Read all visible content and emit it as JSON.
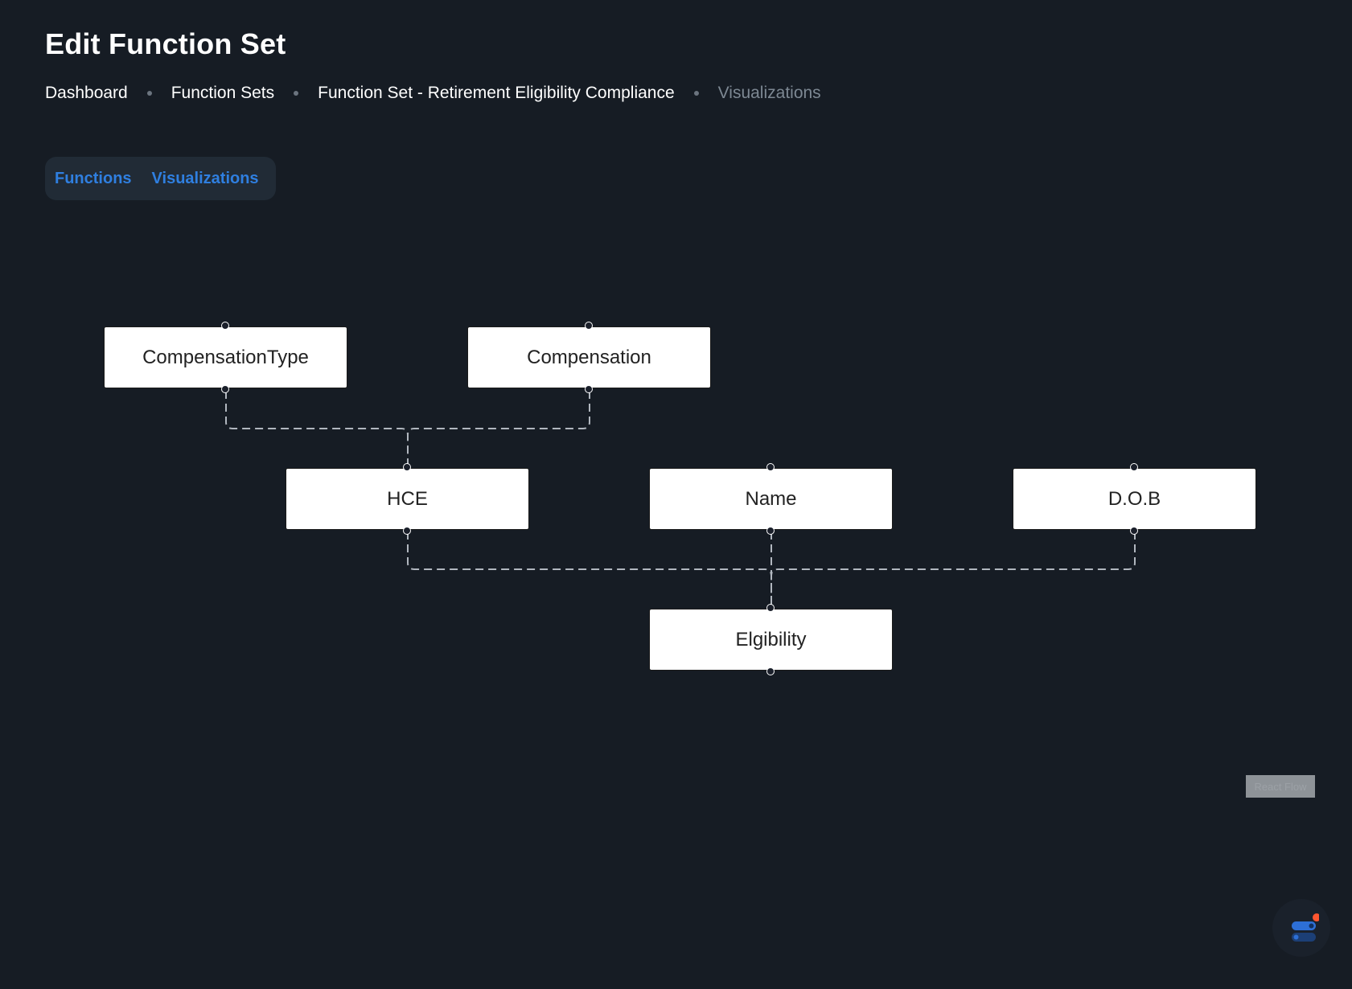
{
  "header": {
    "title": "Edit Function Set"
  },
  "breadcrumb": {
    "items": [
      "Dashboard",
      "Function Sets",
      "Function Set - Retirement Eligibility Compliance",
      "Visualizations"
    ]
  },
  "tabs": [
    "Functions",
    "Visualizations"
  ],
  "flow": {
    "nodes": [
      {
        "id": "compensation-type",
        "label": "CompensationType"
      },
      {
        "id": "compensation",
        "label": "Compensation"
      },
      {
        "id": "hce",
        "label": "HCE"
      },
      {
        "id": "name",
        "label": "Name"
      },
      {
        "id": "dob",
        "label": "D.O.B"
      },
      {
        "id": "eligibility",
        "label": "Elgibility"
      }
    ],
    "edges": [
      {
        "from": "compensation-type",
        "to": "hce"
      },
      {
        "from": "compensation",
        "to": "hce"
      },
      {
        "from": "hce",
        "to": "eligibility"
      },
      {
        "from": "name",
        "to": "eligibility"
      },
      {
        "from": "dob",
        "to": "eligibility"
      }
    ],
    "attribution": "React Flow"
  },
  "colors": {
    "background": "#161c24",
    "accent": "#2f7fe0",
    "edge": "#b1b7bf",
    "notification": "#ff5630"
  },
  "icons": {
    "settings_fab": "toggle-settings-icon"
  }
}
